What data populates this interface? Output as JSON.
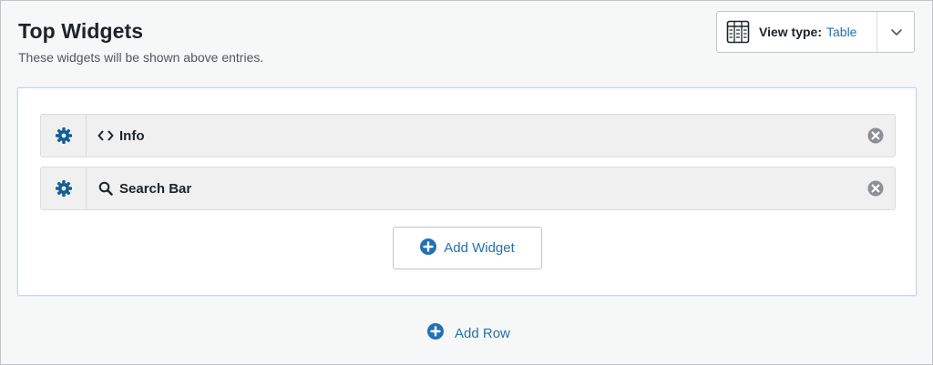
{
  "header": {
    "title": "Top Widgets",
    "subtitle": "These widgets will be shown above entries."
  },
  "view_type": {
    "label": "View type:",
    "value": "Table",
    "icon": "table-icon",
    "dropdown_icon": "chevron-down-icon"
  },
  "widgets": [
    {
      "label": "Info",
      "icon": "code-icon",
      "settings_icon": "gear-icon",
      "remove_icon": "remove-circle-icon"
    },
    {
      "label": "Search Bar",
      "icon": "search-icon",
      "settings_icon": "gear-icon",
      "remove_icon": "remove-circle-icon"
    }
  ],
  "actions": {
    "add_widget": "Add Widget",
    "add_row": "Add Row"
  },
  "colors": {
    "accent": "#2271b1",
    "text": "#1d2327",
    "muted": "#50575e",
    "icon_gray": "#8c8f94"
  }
}
